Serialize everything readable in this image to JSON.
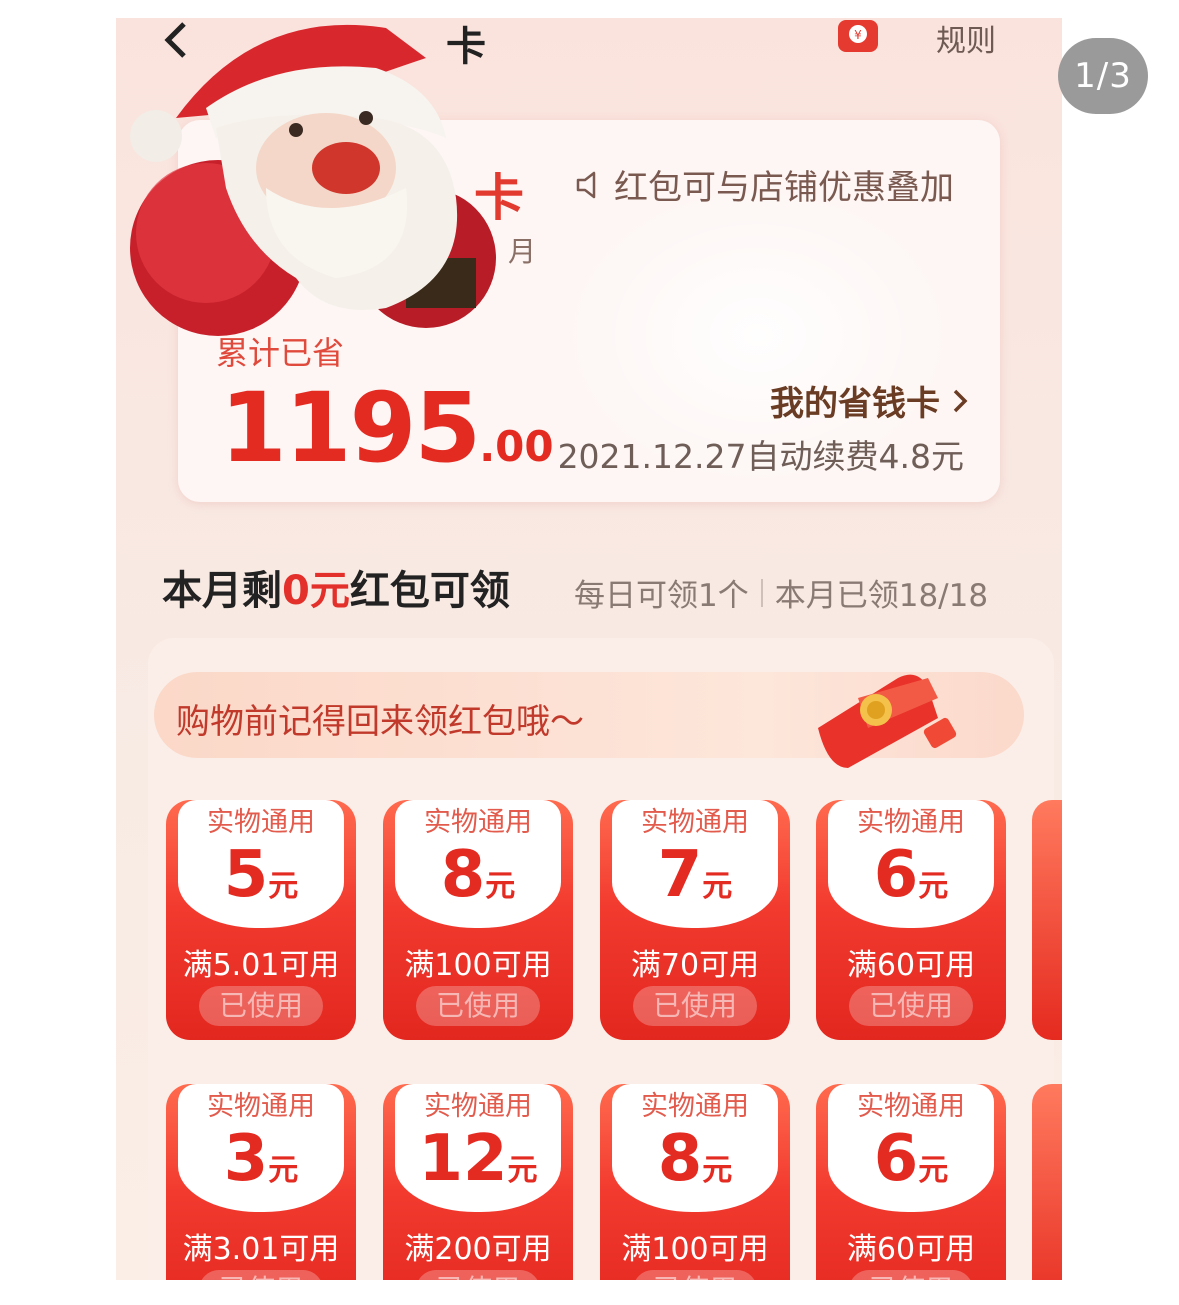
{
  "overlay": {
    "page_counter": "1/3"
  },
  "header": {
    "title_fragment": "卡",
    "rules": "规则"
  },
  "card": {
    "title_fragment": "卡",
    "sub_fragment": "月",
    "notice": "红包可与店铺优惠叠加",
    "saved_label": "累计已省",
    "saved_amount_int": "1195",
    "saved_amount_dec": ".00",
    "my_card_link": "我的省钱卡",
    "renew_text": "2021.12.27自动续费4.8元"
  },
  "month": {
    "title_pre": "本月剩",
    "title_amount": "0元",
    "title_post": "红包可领",
    "daily": "每日可领1个",
    "claimed": "本月已领18/18"
  },
  "reminder": "购物前记得回来领红包哦～",
  "coupons": [
    {
      "tag": "实物通用",
      "value": "5",
      "unit": "元",
      "condition": "满5.01可用",
      "status": "已使用"
    },
    {
      "tag": "实物通用",
      "value": "8",
      "unit": "元",
      "condition": "满100可用",
      "status": "已使用"
    },
    {
      "tag": "实物通用",
      "value": "7",
      "unit": "元",
      "condition": "满70可用",
      "status": "已使用"
    },
    {
      "tag": "实物通用",
      "value": "6",
      "unit": "元",
      "condition": "满60可用",
      "status": "已使用"
    },
    {
      "tag": "实物通用",
      "value": "3",
      "unit": "元",
      "condition": "满3.01可用",
      "status": "已使用"
    },
    {
      "tag": "实物通用",
      "value": "12",
      "unit": "元",
      "condition": "满200可用",
      "status": "已使用"
    },
    {
      "tag": "实物通用",
      "value": "8",
      "unit": "元",
      "condition": "满100可用",
      "status": "已使用"
    },
    {
      "tag": "实物通用",
      "value": "6",
      "unit": "元",
      "condition": "满60可用",
      "status": "已使用"
    }
  ],
  "icons": [
    "back-icon",
    "redpack-icon",
    "speaker-icon",
    "chevron-right-icon",
    "santa-sticker"
  ],
  "colors": {
    "accent_red": "#e32b22",
    "coupon_red": "#f23a2f"
  }
}
